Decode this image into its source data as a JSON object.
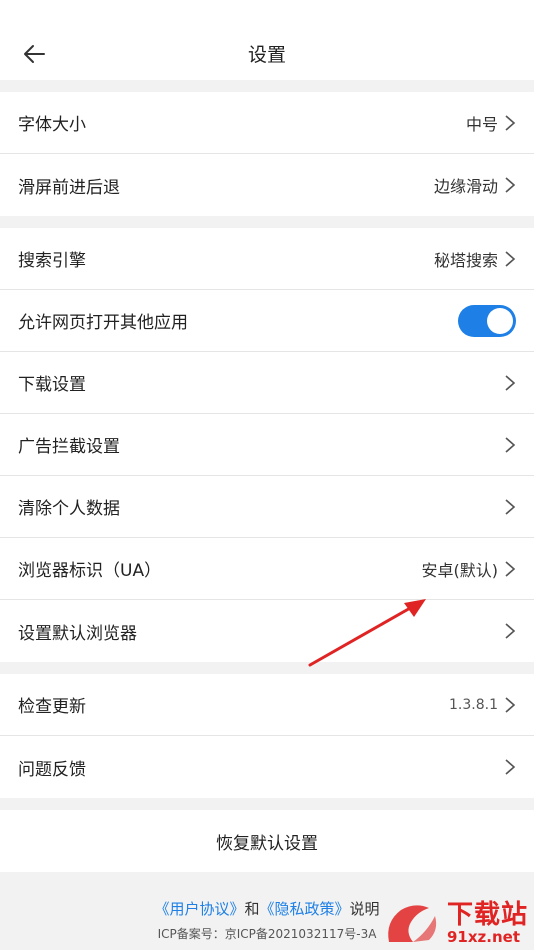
{
  "header": {
    "title": "设置"
  },
  "group1": [
    {
      "label": "字体大小",
      "value": "中号"
    },
    {
      "label": "滑屏前进后退",
      "value": "边缘滑动"
    }
  ],
  "group2": [
    {
      "label": "搜索引擎",
      "value": "秘塔搜索"
    },
    {
      "label": "允许网页打开其他应用",
      "toggle_on": true
    },
    {
      "label": "下载设置"
    },
    {
      "label": "广告拦截设置"
    },
    {
      "label": "清除个人数据"
    },
    {
      "label": "浏览器标识（UA）",
      "value": "安卓(默认)"
    },
    {
      "label": "设置默认浏览器"
    }
  ],
  "group3": [
    {
      "label": "检查更新",
      "value": "1.3.8.1"
    },
    {
      "label": "问题反馈"
    }
  ],
  "reset": {
    "label": "恢复默认设置"
  },
  "footer": {
    "user_agreement": "《用户协议》",
    "and": "和",
    "privacy_policy": "《隐私政策》",
    "explain": "说明",
    "icp": "ICP备案号：京ICP备2021032117号-3A"
  },
  "watermark": {
    "big": "下载站",
    "small": "91xz.net"
  },
  "colors": {
    "accent": "#1e80e6",
    "annotation": "#e02424"
  }
}
